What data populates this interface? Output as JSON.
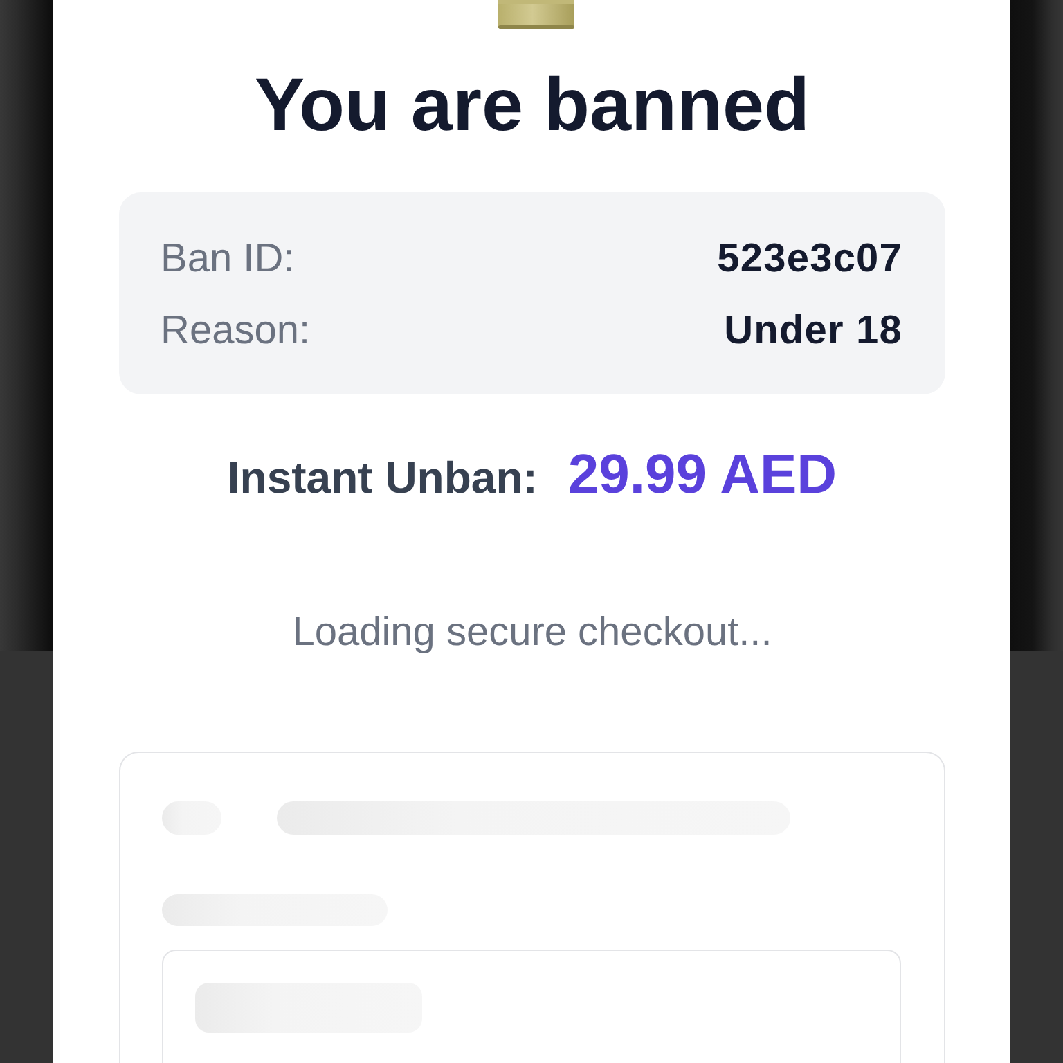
{
  "header": {
    "title": "You are banned"
  },
  "ban_details": [
    {
      "label": "Ban ID:",
      "value": "523e3c07"
    },
    {
      "label": "Reason:",
      "value": "Under 18"
    }
  ],
  "unban_offer": {
    "label": "Instant Unban:",
    "price": "29.99 AED"
  },
  "checkout": {
    "status": "Loading secure checkout..."
  }
}
